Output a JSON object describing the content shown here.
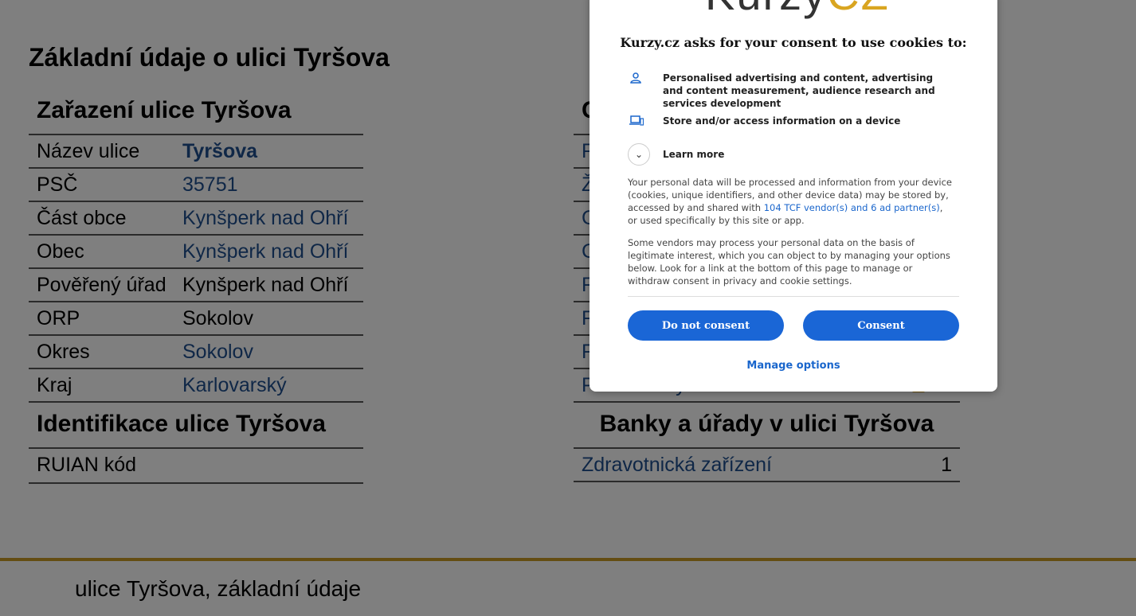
{
  "page": {
    "heading": "Základní údaje o ulici Tyršova",
    "zarazeni_title": "Zařazení ulice Tyršova",
    "rows": [
      {
        "label": "Název ulice",
        "value": "Tyršova"
      },
      {
        "label": "PSČ",
        "value": "35751"
      },
      {
        "label": "Část obce",
        "value": "Kynšperk nad Ohří"
      },
      {
        "label": "Obec",
        "value": "Kynšperk nad Ohří"
      },
      {
        "label": "Pověřený úřad",
        "value": "Kynšperk nad Ohří"
      },
      {
        "label": "ORP",
        "value": "Sokolov"
      },
      {
        "label": "Okres",
        "value": "Sokolov"
      },
      {
        "label": "Kraj",
        "value": "Karlovarský"
      }
    ],
    "identifikace_title": "Identifikace ulice Tyršova",
    "ruian_label": "RUIAN kód",
    "right_partial": {
      "title_fragment": "C",
      "row_fragments": [
        "F",
        "Ž",
        "C",
        "C",
        "F",
        "F",
        "F"
      ]
    },
    "provozovny_label": "Provozovny historie",
    "provozovny_count": "15",
    "banky_title": "Banky a úřady v ulici Tyršova",
    "zdravotnicka_label": "Zdravotnická zařízení",
    "zdravotnicka_count": "1",
    "footer_text": "ulice Tyršova, základní údaje"
  },
  "consent": {
    "logo_main": "Kurzy",
    "logo_accent": "CZ",
    "title": "Kurzy.cz asks for your consent to use cookies to:",
    "purpose1": "Personalised advertising and content, advertising and content measurement, audience research and services development",
    "purpose2": "Store and/or access information on a device",
    "learn_more": "Learn more",
    "para1_a": "Your personal data will be processed and information from your device (cookies, unique identifiers, and other device data) may be stored by, accessed by and shared with ",
    "para1_link": "104 TCF vendor(s) and 6 ad partner(s)",
    "para1_b": ", or used specifically by this site or app.",
    "para2": "Some vendors may process your personal data on the basis of legitimate interest, which you can object to by managing your options below. Look for a link at the bottom of this page to manage or withdraw consent in privacy and cookie settings.",
    "btn_reject": "Do not consent",
    "btn_accept": "Consent",
    "manage": "Manage options"
  },
  "colors": {
    "accent": "#1a66d6",
    "link": "#1f4f8f",
    "footer_line": "#c99b25"
  }
}
